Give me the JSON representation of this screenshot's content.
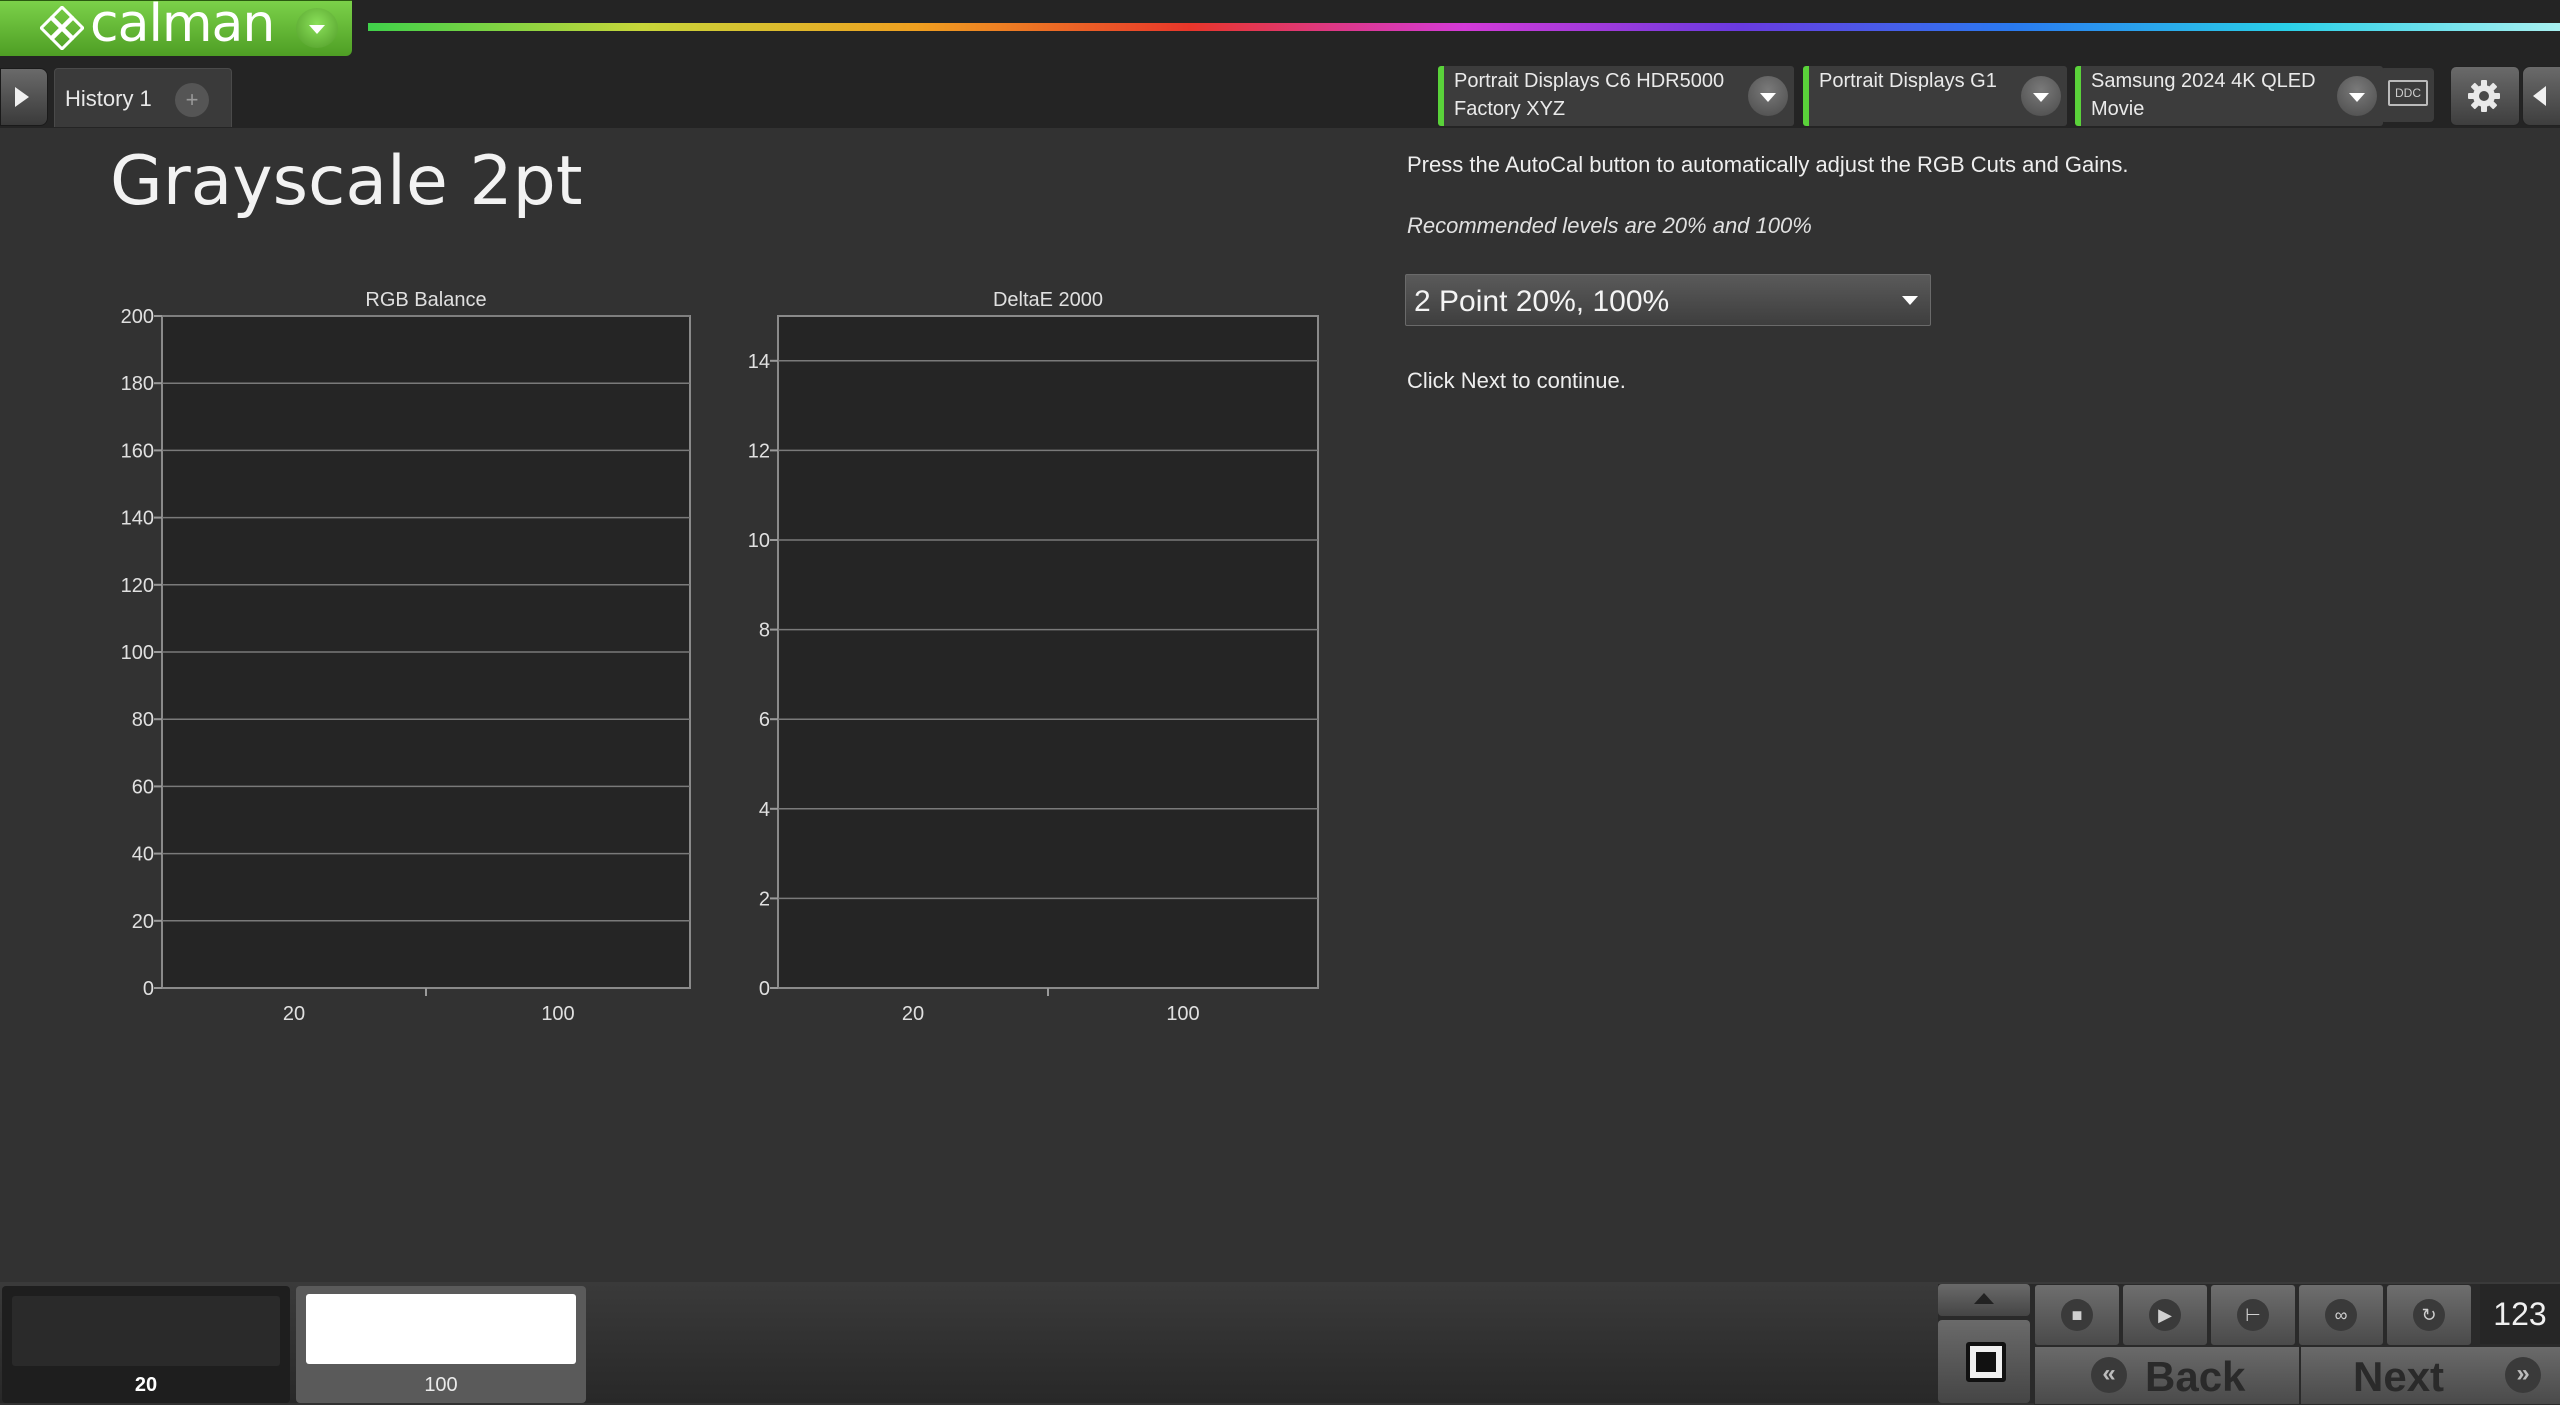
{
  "app": {
    "name": "calman"
  },
  "tabs": [
    {
      "label": "History 1"
    }
  ],
  "devices": [
    {
      "line1": "Portrait Displays C6 HDR5000",
      "line2": "Factory XYZ"
    },
    {
      "line1": "Portrait Displays G1",
      "line2": ""
    },
    {
      "line1": "Samsung 2024 4K QLED",
      "line2": "Movie"
    }
  ],
  "ddc_label": "DDC",
  "page": {
    "title": "Grayscale 2pt",
    "instruction1": "Press the AutoCal button to automatically adjust the RGB Cuts and Gains.",
    "instruction2": "Recommended levels are 20% and 100%",
    "level_select": "2 Point 20%, 100%",
    "instruction3": "Click Next to continue."
  },
  "chart_data": [
    {
      "type": "bar",
      "title": "RGB Balance",
      "categories": [
        "20",
        "100"
      ],
      "series": [],
      "ylim": [
        0,
        200
      ],
      "yticks": [
        0,
        20,
        40,
        60,
        80,
        100,
        120,
        140,
        160,
        180,
        200
      ],
      "grid": true
    },
    {
      "type": "bar",
      "title": "DeltaE 2000",
      "categories": [
        "20",
        "100"
      ],
      "series": [],
      "ylim": [
        0,
        15
      ],
      "yticks": [
        0,
        2,
        4,
        6,
        8,
        10,
        12,
        14
      ],
      "grid": true
    }
  ],
  "swatches": [
    {
      "label": "20",
      "color": "#2a2a2a",
      "selected": true
    },
    {
      "label": "100",
      "color": "#ffffff",
      "selected": false
    }
  ],
  "controls": {
    "tools": [
      "stop-icon",
      "play-icon",
      "measure-icon",
      "loop-icon",
      "refresh-icon"
    ],
    "pattern_count": "123",
    "back_label": "Back",
    "next_label": "Next"
  },
  "colors": {
    "accent_green": "#5ad23a",
    "background": "#323232"
  }
}
